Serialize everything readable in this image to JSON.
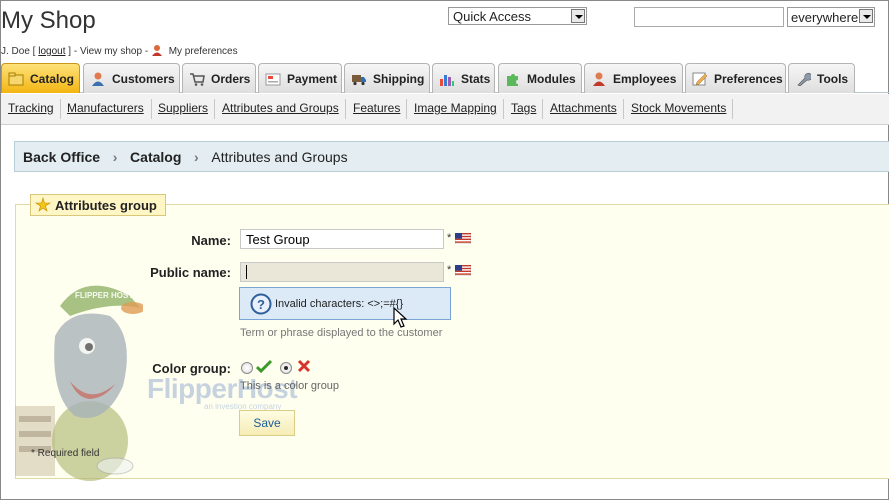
{
  "header": {
    "shop_title": "My Shop",
    "user_name": "J. Doe [",
    "logout": "logout",
    "user_close": "] - ",
    "view_shop": "View my shop",
    "separator": " - ",
    "preferences": "My preferences",
    "quick_access": "Quick Access",
    "search_value": "",
    "search_scope": "everywhere"
  },
  "tabs": [
    {
      "label": "Catalog",
      "icon": "catalog-icon",
      "active": true
    },
    {
      "label": "Customers",
      "icon": "customers-icon"
    },
    {
      "label": "Orders",
      "icon": "orders-icon"
    },
    {
      "label": "Payment",
      "icon": "payment-icon"
    },
    {
      "label": "Shipping",
      "icon": "shipping-icon"
    },
    {
      "label": "Stats",
      "icon": "stats-icon"
    },
    {
      "label": "Modules",
      "icon": "modules-icon"
    },
    {
      "label": "Employees",
      "icon": "employees-icon"
    },
    {
      "label": "Preferences",
      "icon": "preferences-icon"
    },
    {
      "label": "Tools",
      "icon": "tools-icon"
    }
  ],
  "subtabs": [
    "Tracking",
    "Manufacturers",
    "Suppliers",
    "Attributes and Groups",
    "Features",
    "Image Mapping",
    "Tags",
    "Attachments",
    "Stock Movements"
  ],
  "breadcrumb": [
    "Back Office",
    "Catalog",
    "Attributes and Groups"
  ],
  "form": {
    "legend": "Attributes group",
    "name_label": "Name:",
    "name_value": "Test Group",
    "public_name_label": "Public name:",
    "public_name_value": "",
    "required_mark": "*",
    "tooltip": "Invalid characters: <>;=#{}",
    "public_hint": "Term or phrase displayed to the customer",
    "color_group_label": "Color group:",
    "color_hint": "This is a color group",
    "save_label": "Save",
    "required_note": "* Required field"
  },
  "watermark": {
    "cap_text": "FLIPPER HOST",
    "logo": "FlipperHost",
    "tagline": "an investion company"
  },
  "colors": {
    "active_tab": "#f4b512",
    "breadcrumb_bg": "#e4eef2",
    "tooltip_bg": "#dce9f7",
    "link_blue": "#1a5d9b"
  }
}
